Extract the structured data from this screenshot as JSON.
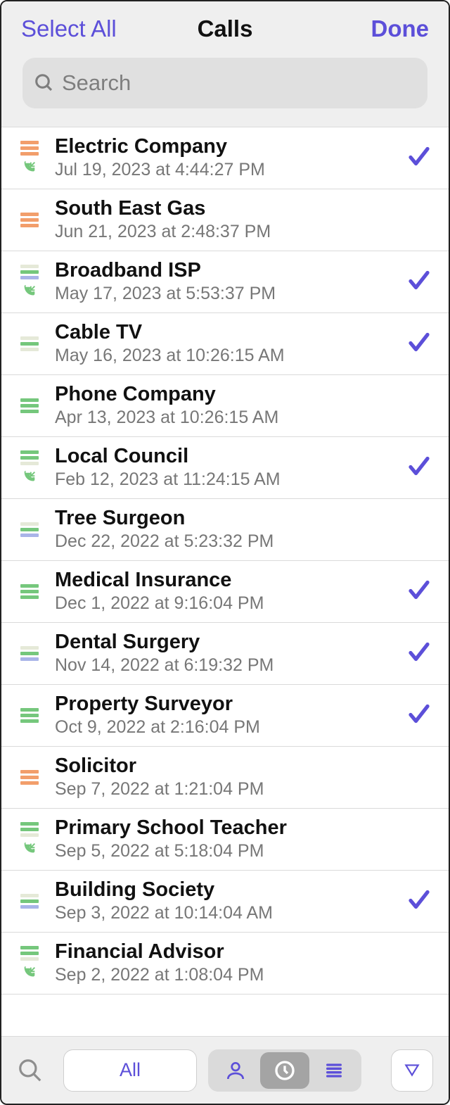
{
  "header": {
    "select_all": "Select All",
    "title": "Calls",
    "done": "Done"
  },
  "search": {
    "placeholder": "Search"
  },
  "toolbar": {
    "all_label": "All"
  },
  "calls": [
    {
      "name": "Electric Company",
      "date": "Jul 19, 2023 at 4:44:27 PM",
      "bars": "orange",
      "incoming": true,
      "checked": true
    },
    {
      "name": "South East Gas",
      "date": "Jun 21, 2023 at 2:48:37 PM",
      "bars": "orange",
      "incoming": false,
      "checked": false
    },
    {
      "name": "Broadband ISP",
      "date": "May 17, 2023 at 5:53:37 PM",
      "bars": "mixed",
      "incoming": true,
      "checked": true
    },
    {
      "name": "Cable TV",
      "date": "May 16, 2023 at 10:26:15 AM",
      "bars": "light-green",
      "incoming": false,
      "checked": true
    },
    {
      "name": "Phone Company",
      "date": "Apr 13, 2023 at 10:26:15 AM",
      "bars": "green",
      "incoming": false,
      "checked": false
    },
    {
      "name": "Local Council",
      "date": "Feb 12, 2023 at 11:24:15 AM",
      "bars": "green-top",
      "incoming": true,
      "checked": true
    },
    {
      "name": "Tree Surgeon",
      "date": "Dec 22, 2022 at 5:23:32 PM",
      "bars": "mixed",
      "incoming": false,
      "checked": false
    },
    {
      "name": "Medical Insurance",
      "date": "Dec 1, 2022 at 9:16:04 PM",
      "bars": "green",
      "incoming": false,
      "checked": true
    },
    {
      "name": "Dental Surgery",
      "date": "Nov 14, 2022 at 6:19:32 PM",
      "bars": "mixed",
      "incoming": false,
      "checked": true
    },
    {
      "name": "Property Surveyor",
      "date": "Oct 9, 2022 at 2:16:04 PM",
      "bars": "green",
      "incoming": false,
      "checked": true
    },
    {
      "name": "Solicitor",
      "date": "Sep 7, 2022 at 1:21:04 PM",
      "bars": "orange",
      "incoming": false,
      "checked": false
    },
    {
      "name": "Primary School Teacher",
      "date": "Sep 5, 2022 at 5:18:04 PM",
      "bars": "green-top",
      "incoming": true,
      "checked": false
    },
    {
      "name": "Building Society",
      "date": "Sep 3, 2022 at 10:14:04 AM",
      "bars": "mixed",
      "incoming": false,
      "checked": true
    },
    {
      "name": "Financial Advisor",
      "date": "Sep 2, 2022 at 1:08:04 PM",
      "bars": "green-top",
      "incoming": true,
      "checked": false
    }
  ]
}
